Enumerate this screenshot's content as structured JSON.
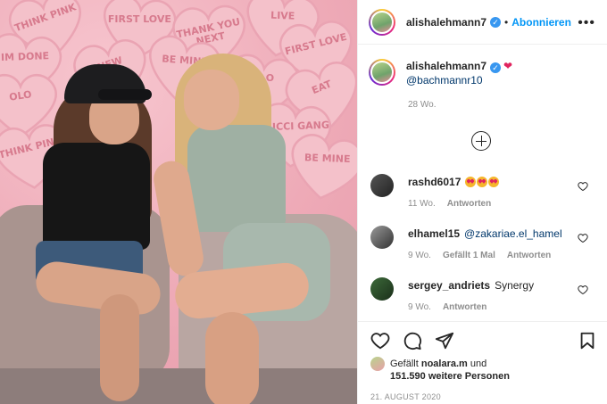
{
  "post": {
    "username": "alishalehmann7",
    "follow_label": "Abonnieren",
    "caption_mention": "@bachmannr10",
    "caption_time": "28 Wo.",
    "date": "21. AUGUST 2020"
  },
  "photo": {
    "hearts": [
      "THINK PINK",
      "FIRST LOVE",
      "THANK YOU NEXT",
      "LIVE",
      "IM DONE",
      "NEW",
      "BE MINE",
      "FIRST LOVE",
      "OLO",
      "OLO",
      "EAT",
      "GUCCI GANG",
      "THINK PINK",
      "BE MINE"
    ]
  },
  "comments": [
    {
      "user": "rashd6017",
      "text": "",
      "emoji_count": 3,
      "time": "11 Wo.",
      "likes": "",
      "reply": "Antworten"
    },
    {
      "user": "elhamel15",
      "text": "@zakariae.el_hamel",
      "emoji_count": 0,
      "time": "9 Wo.",
      "likes": "Gefällt 1 Mal",
      "reply": "Antworten"
    },
    {
      "user": "sergey_andriets",
      "text": "Synergy",
      "emoji_count": 0,
      "time": "9 Wo.",
      "likes": "",
      "reply": "Antworten"
    }
  ],
  "likes": {
    "prefix": "Gefällt",
    "user": "noalara.m",
    "middle": "und",
    "count": "151.590 weitere Personen"
  },
  "colors": {
    "link": "#0095f6",
    "verified": "#3897f0",
    "heart": "#e0245e"
  }
}
